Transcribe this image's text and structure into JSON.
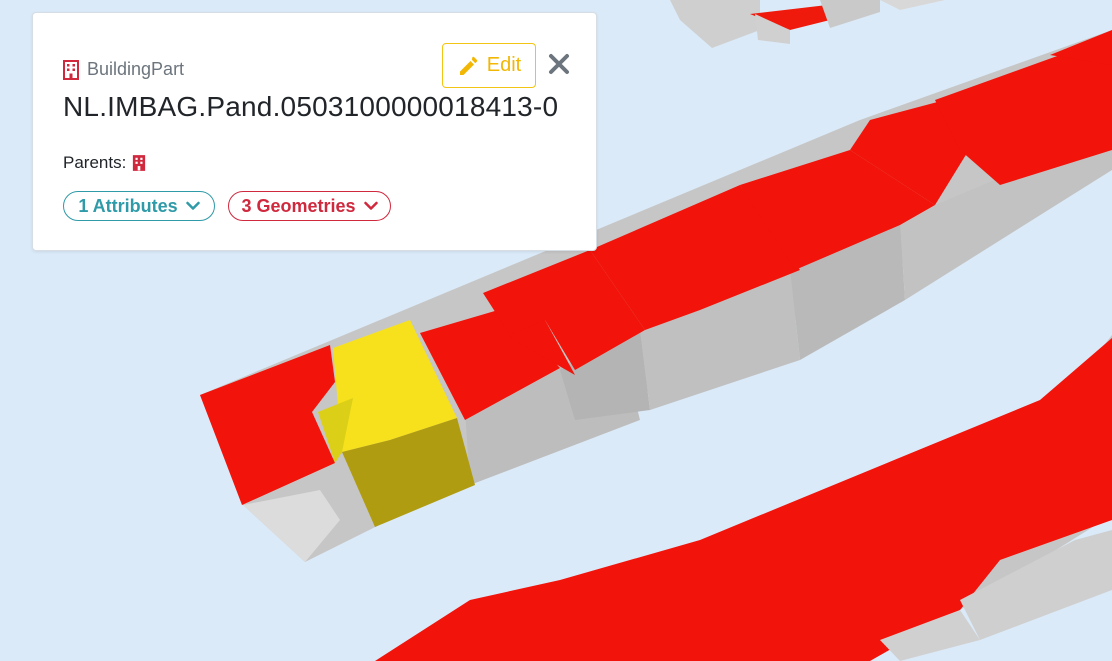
{
  "info_panel": {
    "object_type": "BuildingPart",
    "object_id": "NL.IMBAG.Pand.0503100000018413-0",
    "edit_label": "Edit",
    "parents_label": "Parents:",
    "attributes_button": "1 Attributes",
    "geometries_button": "3 Geometries"
  },
  "icons": {
    "type": "building-icon",
    "edit": "pencil-icon",
    "close": "close-icon",
    "parent": "building-icon",
    "attributes_toggle": "chevron-down-icon",
    "geometries_toggle": "chevron-down-icon"
  },
  "colors": {
    "sky": "#dbeaf8",
    "building_roof": "#f2130a",
    "building_wall": "#c9c9c9",
    "selected_roof": "#f6e11c",
    "selected_wall": "#b09c10",
    "attributes_accent": "#2f9aa8",
    "geometries_accent": "#d0293e",
    "edit_accent": "#f2b705"
  }
}
